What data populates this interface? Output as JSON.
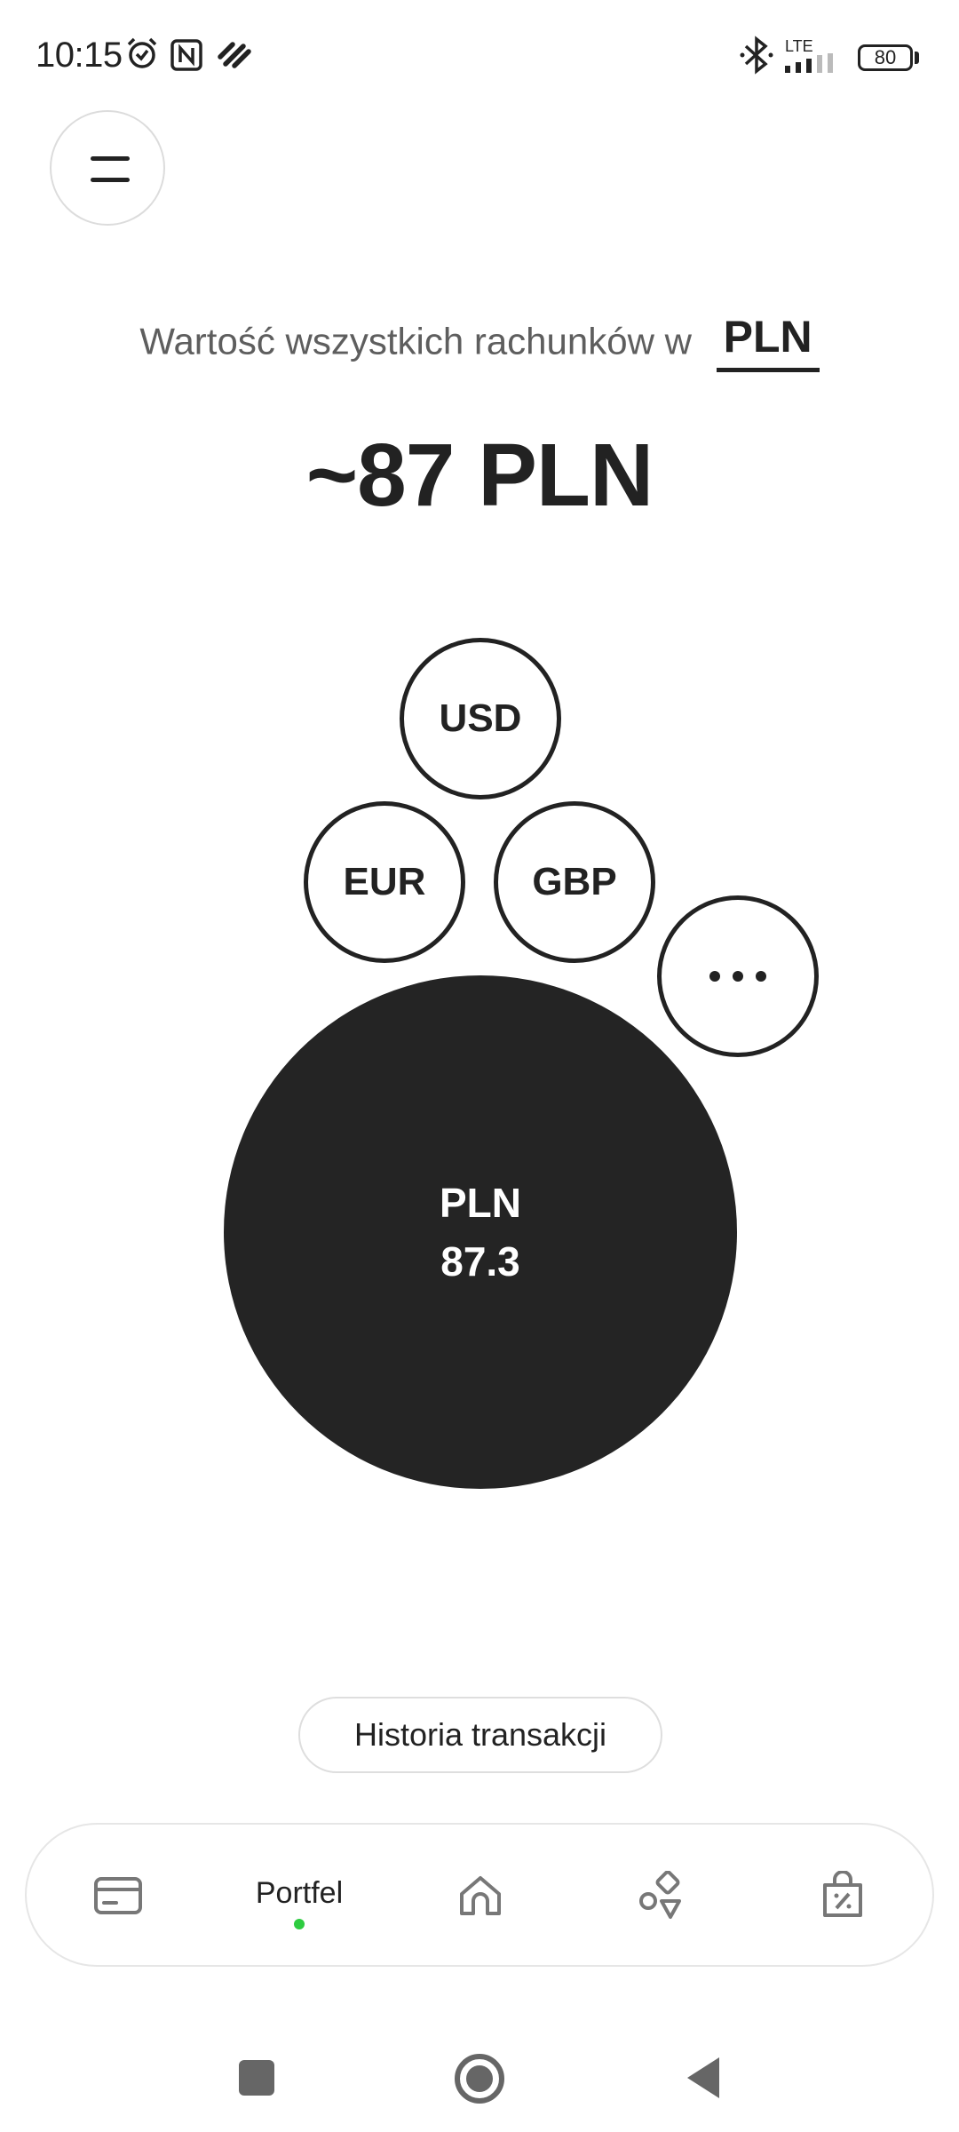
{
  "status_bar": {
    "time": "10:15",
    "network": "LTE",
    "battery": "80",
    "icons": [
      "alarm-icon",
      "nfc-icon",
      "app-notification-icon",
      "bluetooth-icon",
      "signal-icon",
      "battery-icon"
    ]
  },
  "header": {
    "menu_icon": "hamburger-menu-icon"
  },
  "summary": {
    "label": "Wartość wszystkich rachunków w",
    "currency": "PLN",
    "total": "~87 PLN"
  },
  "bubbles": {
    "usd": "USD",
    "eur": "EUR",
    "gbp": "GBP",
    "more_icon": "more-dots-icon",
    "main_currency": "PLN",
    "main_amount": "87.3"
  },
  "history_button": "Historia transakcji",
  "bottom_nav": {
    "items": [
      {
        "icon": "card-icon",
        "label": ""
      },
      {
        "icon": "",
        "label": "Portfel",
        "active": true
      },
      {
        "icon": "home-icon",
        "label": ""
      },
      {
        "icon": "shapes-icon",
        "label": ""
      },
      {
        "icon": "discount-bag-icon",
        "label": ""
      }
    ],
    "active_indicator_color": "#2ecc40"
  },
  "system_nav": {
    "icons": [
      "recents-icon",
      "home-circle-icon",
      "back-icon"
    ]
  },
  "colors": {
    "text": "#222222",
    "muted_text": "#5e5e5e",
    "main_bubble": "#242424",
    "background": "#ffffff"
  }
}
